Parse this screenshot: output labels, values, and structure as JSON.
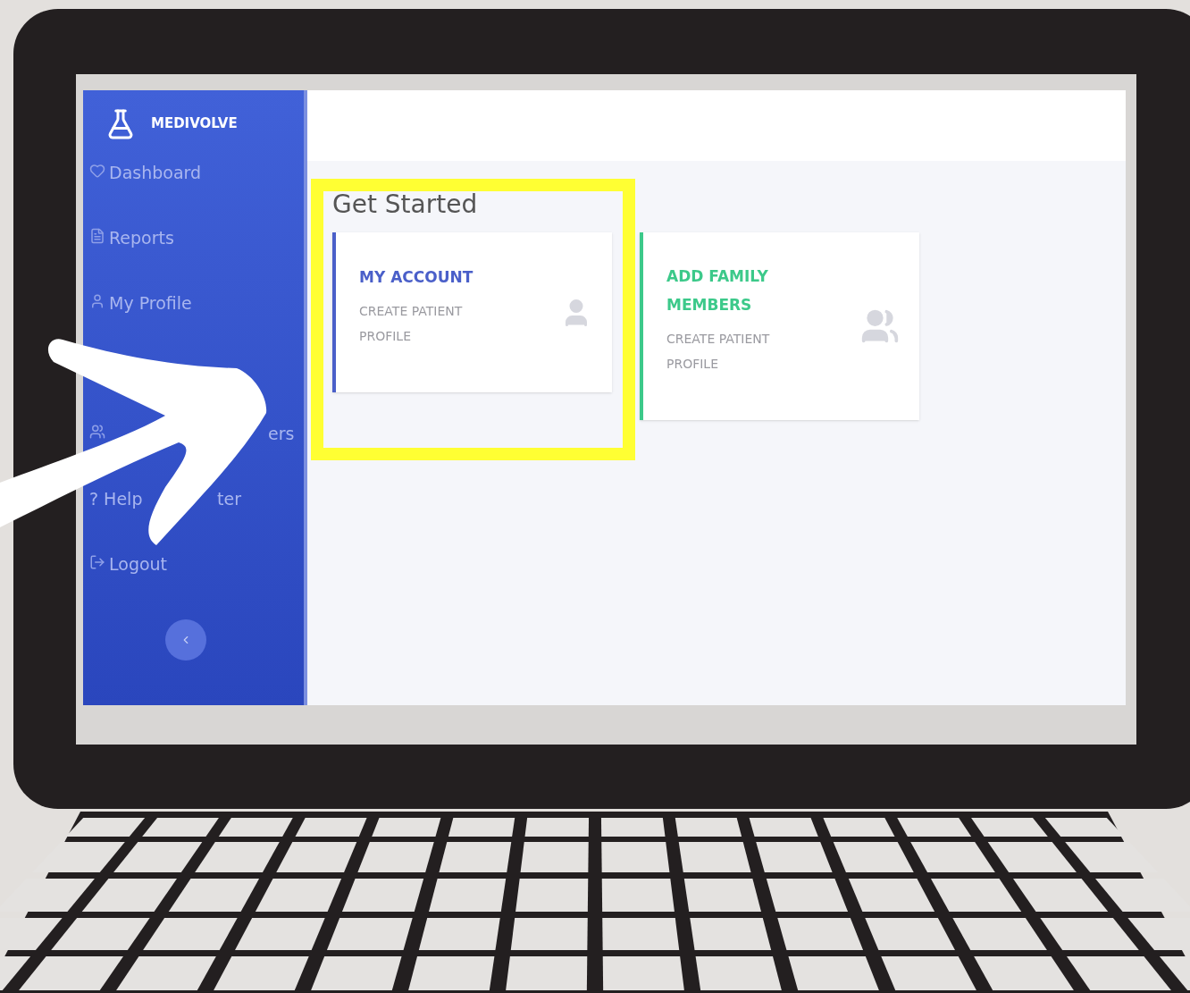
{
  "brand": "MEDIVOLVE",
  "sidebar": {
    "items": [
      {
        "kind": "link",
        "parts": [
          "Dashboard"
        ]
      },
      {
        "kind": "link",
        "parts": [
          "Reports"
        ]
      },
      {
        "kind": "link",
        "parts": [
          "My Profile"
        ]
      },
      {
        "kind": "icon"
      },
      {
        "kind": "link",
        "parts": [
          "ers"
        ]
      },
      {
        "kind": "link",
        "parts": [
          "? Help",
          "ter"
        ]
      },
      {
        "kind": "link",
        "parts": [
          "Logout"
        ]
      }
    ]
  },
  "main": {
    "heading": "Get Started",
    "cards": [
      {
        "kind": "single",
        "title": "MY ACCOUNT",
        "subtitle": "CREATE PATIENT PROFILE",
        "color": "#4a5fc9",
        "highlighted": true
      },
      {
        "kind": "group",
        "title": "ADD FAMILY MEMBERS",
        "subtitle": "CREATE PATIENT PROFILE",
        "color": "#3cc98a",
        "highlighted": false
      }
    ]
  }
}
